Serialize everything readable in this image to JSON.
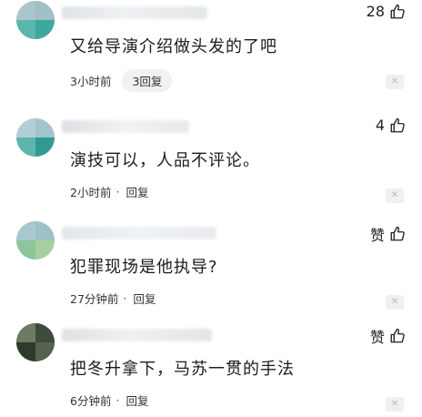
{
  "comments": [
    {
      "text": "又给导演介绍做头发的了吧",
      "time": "3小时前",
      "reply_label": "3回复",
      "like_count": "28",
      "reply_style": "pill"
    },
    {
      "text": "演技可以，人品不评论。",
      "time": "2小时前",
      "reply_label": "回复",
      "like_count": "4",
      "reply_style": "plain"
    },
    {
      "text": "犯罪现场是他执导?",
      "time": "27分钟前",
      "reply_label": "回复",
      "like_count": "赞",
      "reply_style": "plain"
    },
    {
      "text": "把冬升拿下，马苏一贯的手法",
      "time": "6分钟前",
      "reply_label": "回复",
      "like_count": "赞",
      "reply_style": "plain"
    }
  ],
  "meta_separator": "·",
  "close_glyph": "✕",
  "icons": {
    "like": "thumbs-up-icon",
    "close": "close-icon"
  },
  "colors": {
    "text": "#1c1c1c",
    "meta": "#333333",
    "pill_bg": "#f1f1f1",
    "close_bg": "#f0f0f0"
  }
}
